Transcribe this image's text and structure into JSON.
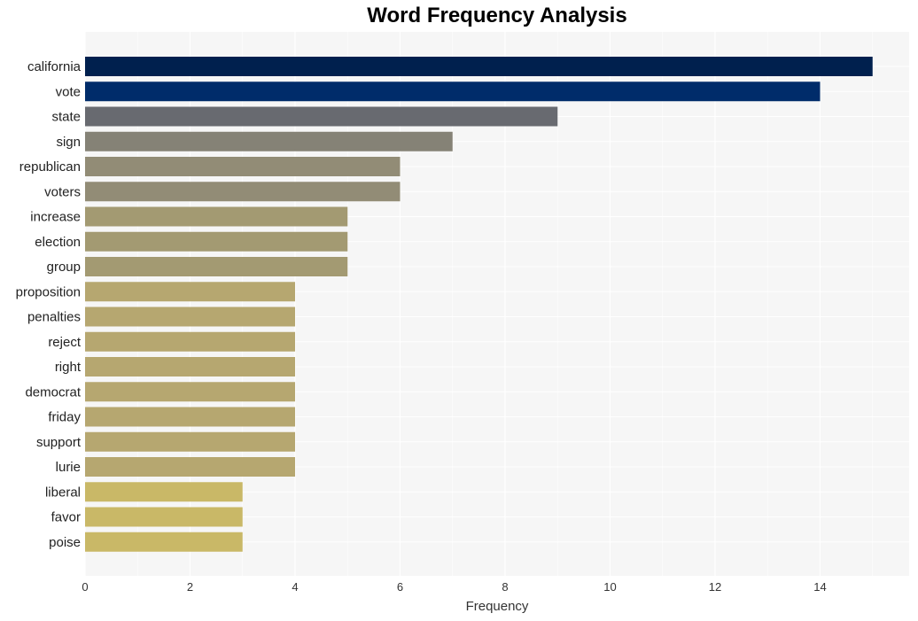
{
  "chart_data": {
    "type": "bar",
    "orientation": "horizontal",
    "title": "Word Frequency Analysis",
    "xlabel": "Frequency",
    "ylabel": "",
    "xlim": [
      0,
      15.7
    ],
    "xticks": [
      0,
      2,
      4,
      6,
      8,
      10,
      12,
      14
    ],
    "grid": true,
    "categories": [
      "california",
      "vote",
      "state",
      "sign",
      "republican",
      "voters",
      "increase",
      "election",
      "group",
      "proposition",
      "penalties",
      "reject",
      "right",
      "democrat",
      "friday",
      "support",
      "lurie",
      "liberal",
      "favor",
      "poise"
    ],
    "values": [
      15,
      14,
      9,
      7,
      6,
      6,
      5,
      5,
      5,
      4,
      4,
      4,
      4,
      4,
      4,
      4,
      4,
      3,
      3,
      3
    ],
    "colors": [
      "#00204e",
      "#002c6a",
      "#686a70",
      "#858276",
      "#928c76",
      "#928c76",
      "#a39a72",
      "#a39a72",
      "#a39a72",
      "#b6a770",
      "#b6a770",
      "#b6a770",
      "#b6a770",
      "#b6a770",
      "#b6a770",
      "#b6a770",
      "#b6a770",
      "#c9b867",
      "#c9b867",
      "#c9b867"
    ]
  }
}
